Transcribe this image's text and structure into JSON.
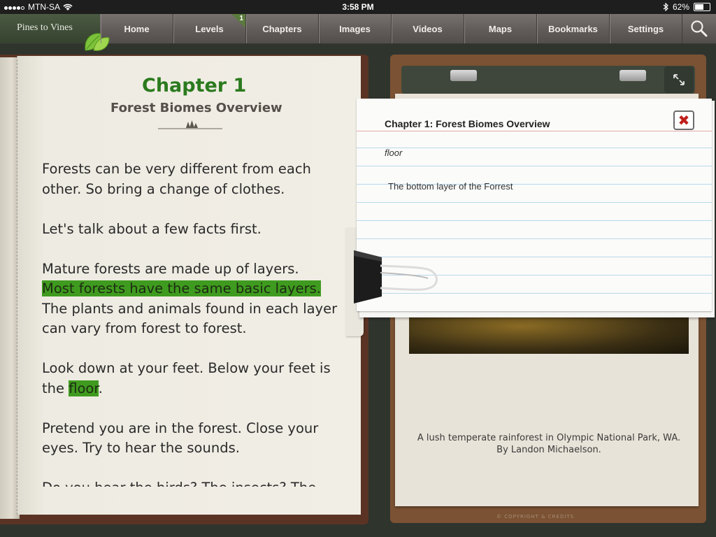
{
  "status_bar": {
    "carrier": "MTN-SA",
    "time": "3:58 PM",
    "battery": "62%",
    "battery_level": 0.62
  },
  "nav": {
    "brand": "Pines to Vines",
    "items": [
      {
        "label": "Home"
      },
      {
        "label": "Levels",
        "badge": "1"
      },
      {
        "label": "Chapters"
      },
      {
        "label": "Images"
      },
      {
        "label": "Videos"
      },
      {
        "label": "Maps"
      },
      {
        "label": "Bookmarks"
      },
      {
        "label": "Settings"
      }
    ],
    "icons": [
      "leaf-icon",
      "search-icon"
    ]
  },
  "book": {
    "chapter": "Chapter 1",
    "subtitle": "Forest Biomes Overview",
    "paragraphs": {
      "p1": "Forests can be very different from each other. So bring a change of clothes.",
      "p2": "Let's talk about a few facts first.",
      "p3_a": "Mature forests are made up of layers.",
      "p3_hl": "Most forests have the same basic layers.",
      "p3_b": "The plants and animals found in each layer can vary from forest to forest.",
      "p4_a": "Look down at your feet. Below your feet is the",
      "p4_hl": "floor",
      "p4_b": ".",
      "p5": "Pretend you are in the forest. Close your eyes. Try to hear the sounds.",
      "p6": "Do you hear the birds? The insects? The"
    },
    "highlight_color": "#3f9b1f"
  },
  "image_panel": {
    "caption_line1": "A lush temperate rainforest in Olympic National Park, WA.",
    "caption_line2": "By Landon Michaelson.",
    "footer": "© COPYRIGHT & CREDITS"
  },
  "note": {
    "title": "Chapter 1: Forest Biomes Overview",
    "term": "floor",
    "definition": "The bottom layer of the Forrest",
    "close_icon": "close-icon"
  }
}
